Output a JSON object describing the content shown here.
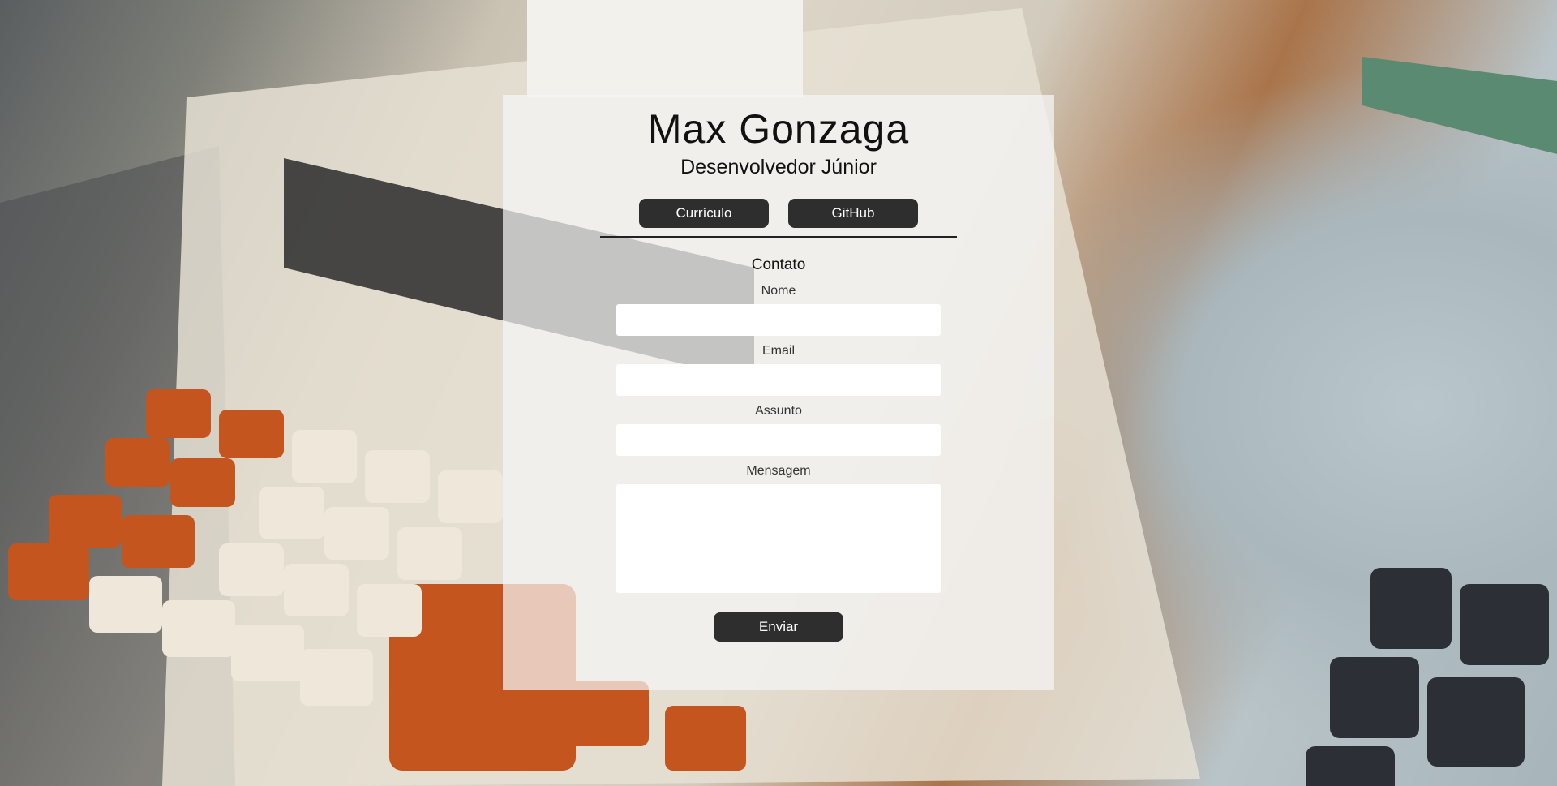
{
  "header": {
    "name": "Max Gonzaga",
    "role": "Desenvolvedor Júnior"
  },
  "links": {
    "curriculo_label": "Currículo",
    "github_label": "GitHub"
  },
  "contact": {
    "title": "Contato",
    "name_label": "Nome",
    "email_label": "Email",
    "subject_label": "Assunto",
    "message_label": "Mensagem",
    "submit_label": "Enviar"
  },
  "background": {
    "description_icon": "calculator-photo"
  }
}
